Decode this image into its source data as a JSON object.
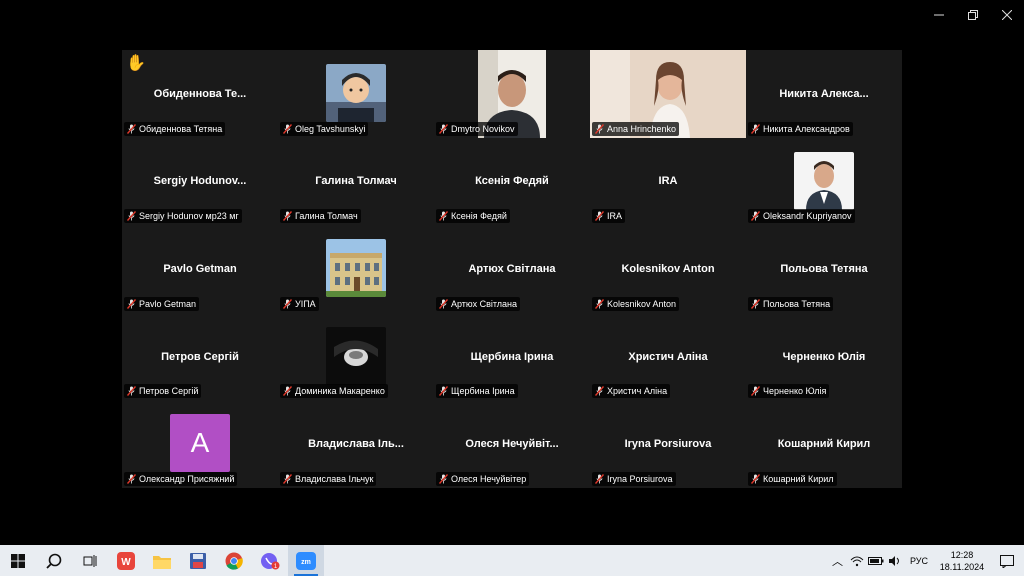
{
  "window": {
    "controls": [
      {
        "name": "minimize-icon"
      },
      {
        "name": "restore-icon"
      },
      {
        "name": "close-icon"
      }
    ]
  },
  "participants": [
    {
      "display": "Обиденнова Те...",
      "plate": "Обиденнова Тетяна",
      "kind": "name",
      "hand": "✋"
    },
    {
      "display": "",
      "plate": "Oleg Tavshunskyi",
      "kind": "avatar-cartoon"
    },
    {
      "display": "",
      "plate": "Dmytro Novikov",
      "kind": "video-man",
      "active": true
    },
    {
      "display": "",
      "plate": "Anna Hrinchenko",
      "kind": "video-woman"
    },
    {
      "display": "Никита Алекса...",
      "plate": "Никита Александров",
      "kind": "name"
    },
    {
      "display": "Sergiy Hodunov...",
      "plate": "Sergiy Hodunov мр23 мг",
      "kind": "name"
    },
    {
      "display": "Галина Толмач",
      "plate": "Галина Толмач",
      "kind": "name"
    },
    {
      "display": "Ксенія Федяй",
      "plate": "Ксенія Федяй",
      "kind": "name"
    },
    {
      "display": "IRA",
      "plate": "IRA",
      "kind": "name"
    },
    {
      "display": "",
      "plate": "Oleksandr Kupriyanov",
      "kind": "photo-man"
    },
    {
      "display": "Pavlo Getman",
      "plate": "Pavlo Getman",
      "kind": "name"
    },
    {
      "display": "",
      "plate": "УІПА",
      "kind": "photo-building"
    },
    {
      "display": "Артюх Світлана",
      "plate": "Артюх Світлана",
      "kind": "name"
    },
    {
      "display": "Kolesnikov Anton",
      "plate": "Kolesnikov Anton",
      "kind": "name"
    },
    {
      "display": "Польова Тетяна",
      "plate": "Польова Тетяна",
      "kind": "name"
    },
    {
      "display": "Петров Сергій",
      "plate": "Петров Сергій",
      "kind": "name"
    },
    {
      "display": "",
      "plate": "Доминика Макаренко",
      "kind": "photo-dark"
    },
    {
      "display": "Щербина Ірина",
      "plate": "Щербина Ірина",
      "kind": "name"
    },
    {
      "display": "Христич Аліна",
      "plate": "Христич Аліна",
      "kind": "name"
    },
    {
      "display": "Черненко Юлія",
      "plate": "Черненко Юлія",
      "kind": "name"
    },
    {
      "display": "",
      "plate": "Олександр Присяжний",
      "kind": "letter",
      "letter": "A",
      "color": "#b14fc5"
    },
    {
      "display": "Владислава Іль...",
      "plate": "Владислава Ільчук",
      "kind": "name"
    },
    {
      "display": "Олеся Нечуйвіт...",
      "plate": "Олеся Нечуйвітер",
      "kind": "name"
    },
    {
      "display": "Iryna Porsiurova",
      "plate": "Iryna Porsiurova",
      "kind": "name"
    },
    {
      "display": "Кошарний Кирил",
      "plate": "Кошарний Кирил",
      "kind": "name"
    }
  ],
  "taskbar": {
    "apps": [
      {
        "name": "windows-start-icon"
      },
      {
        "name": "search-icon"
      },
      {
        "name": "task-view-icon"
      },
      {
        "name": "wps-office-icon"
      },
      {
        "name": "file-explorer-icon"
      },
      {
        "name": "save-app-icon"
      },
      {
        "name": "chrome-icon"
      },
      {
        "name": "viber-icon",
        "badge": "1"
      },
      {
        "name": "zoom-icon",
        "label": "zm"
      }
    ],
    "language": "РУС",
    "time": "12:28",
    "date": "18.11.2024"
  }
}
